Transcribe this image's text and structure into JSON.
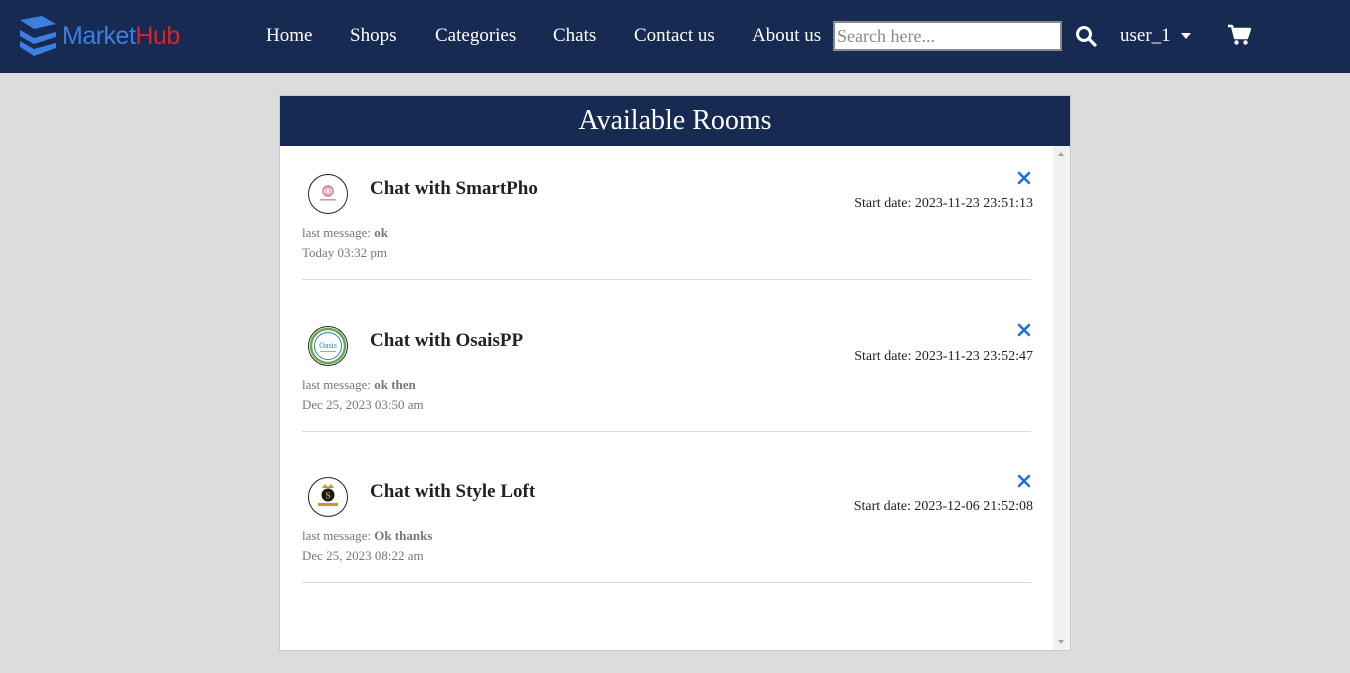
{
  "brand": {
    "part1": "Market",
    "part2": "Hub",
    "color1": "#3d7fe0",
    "color2": "#d8232a"
  },
  "nav": {
    "links": [
      "Home",
      "Shops",
      "Categories",
      "Chats",
      "Contact us",
      "About us"
    ],
    "search_placeholder": "Search here...",
    "user": "user_1",
    "bg_color": "#172a52"
  },
  "panel": {
    "title": "Available Rooms",
    "last_message_label": "last message:",
    "start_date_label": "Start date:",
    "rooms": [
      {
        "title": "Chat with SmartPho",
        "start_date": "2023-11-23 23:51:13",
        "last_message": "ok",
        "time": "Today 03:32 pm",
        "avatar_icon": "smartpho-logo",
        "avatar_text": ""
      },
      {
        "title": "Chat with OsaisPP",
        "start_date": "2023-11-23 23:52:47",
        "last_message": "ok then",
        "time": "Dec 25, 2023 03:50 am",
        "avatar_icon": "oasis-logo",
        "avatar_text": "Oasis"
      },
      {
        "title": "Chat with Style Loft",
        "start_date": "2023-12-06 21:52:08",
        "last_message": "Ok thanks",
        "time": "Dec 25, 2023 08:22 am",
        "avatar_icon": "style-loft-logo",
        "avatar_text": "S"
      }
    ]
  },
  "colors": {
    "accent": "#1e6fe6",
    "header": "#172a52",
    "background": "#dcdcdc"
  }
}
